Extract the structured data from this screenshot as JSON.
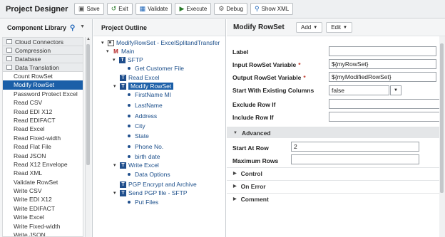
{
  "app": {
    "title": "Project Designer"
  },
  "toolbar": {
    "buttons": [
      {
        "label": "Save",
        "icon": "save-icon"
      },
      {
        "label": "Exit",
        "icon": "exit-icon"
      },
      {
        "label": "Validate",
        "icon": "validate-icon"
      },
      {
        "label": "Execute",
        "icon": "execute-icon"
      },
      {
        "label": "Debug",
        "icon": "debug-icon"
      },
      {
        "label": "Show XML",
        "icon": "search-icon"
      }
    ]
  },
  "library": {
    "title": "Component Library",
    "categories": [
      "Cloud Connectors",
      "Compression",
      "Database",
      "Data Translation"
    ],
    "items": [
      "Count RowSet",
      "Modify RowSet",
      "Password Protect Excel",
      "Read CSV",
      "Read EDI X12",
      "Read EDIFACT",
      "Read Excel",
      "Read Fixed-width",
      "Read Flat File",
      "Read JSON",
      "Read X12 Envelope",
      "Read XML",
      "Validate RowSet",
      "Write CSV",
      "Write EDI X12",
      "Write EDIFACT",
      "Write Excel",
      "Write Fixed-width",
      "Write JSON"
    ],
    "selected": "Modify RowSet"
  },
  "outline": {
    "title": "Project Outline",
    "nodes": [
      {
        "label": "ModifyRowSet - ExcelSplitandTransfer",
        "type": "project"
      },
      {
        "label": "Main",
        "type": "module"
      },
      {
        "label": "SFTP",
        "type": "task"
      },
      {
        "label": "Get Customer File",
        "type": "leaf"
      },
      {
        "label": "Read Excel",
        "type": "task"
      },
      {
        "label": "Modify RowSet",
        "type": "task"
      },
      {
        "label": "FirstName MI",
        "type": "leaf"
      },
      {
        "label": "LastName",
        "type": "leaf"
      },
      {
        "label": "Address",
        "type": "leaf"
      },
      {
        "label": "City",
        "type": "leaf"
      },
      {
        "label": "State",
        "type": "leaf"
      },
      {
        "label": "Phone No.",
        "type": "leaf"
      },
      {
        "label": "birth date",
        "type": "leaf"
      },
      {
        "label": "Write Excel",
        "type": "task"
      },
      {
        "label": "Data Options",
        "type": "leaf"
      },
      {
        "label": "PGP Encrypt and Archive",
        "type": "task"
      },
      {
        "label": "Send PGP file - SFTP",
        "type": "task"
      },
      {
        "label": "Put Files",
        "type": "leaf"
      }
    ]
  },
  "properties": {
    "title": "Modify RowSet",
    "add_label": "Add",
    "edit_label": "Edit",
    "fields": {
      "label": {
        "label": "Label",
        "value": ""
      },
      "input": {
        "label": "Input RowSet Variable",
        "value": "${myRowSet}"
      },
      "output": {
        "label": "Output RowSet Variable",
        "value": "${myModifiedRowSet}"
      },
      "start_existing": {
        "label": "Start With Existing Columns",
        "value": "false"
      },
      "exclude": {
        "label": "Exclude Row If",
        "value": ""
      },
      "include": {
        "label": "Include Row If",
        "value": ""
      }
    },
    "advanced": {
      "title": "Advanced",
      "start_at_row": {
        "label": "Start At Row",
        "value": "2"
      },
      "max_rows": {
        "label": "Maximum Rows",
        "value": ""
      }
    },
    "sections": [
      "Control",
      "On Error",
      "Comment"
    ]
  }
}
